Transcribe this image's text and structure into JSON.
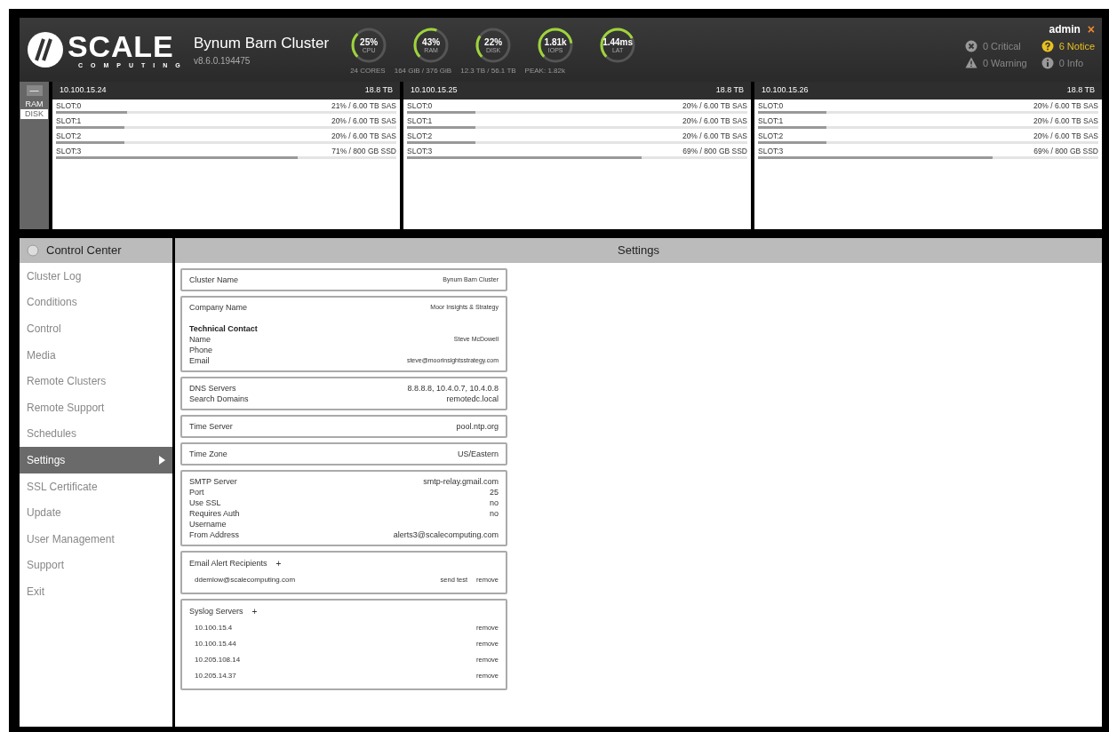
{
  "brand": {
    "logo": "SCALE",
    "tagline": "COMPUTING",
    "version": "v8.6.0.194475",
    "cluster": "Bynum Barn Cluster"
  },
  "gauges": [
    {
      "value": "25%",
      "label": "CPU",
      "level": 0.25
    },
    {
      "value": "43%",
      "label": "RAM",
      "level": 0.43
    },
    {
      "value": "22%",
      "label": "DISK",
      "level": 0.22
    },
    {
      "value": "1.81k",
      "label": "IOPS",
      "level": 0.6
    },
    {
      "value": "1.44ms",
      "label": "LAT",
      "level": 0.55
    }
  ],
  "gauge_notes": [
    "24 CORES",
    "164 GiB / 376 GiB",
    "12.3 TB / 56.1 TB",
    "PEAK: 1.82k"
  ],
  "user": {
    "name": "admin",
    "close": "×"
  },
  "alerts": [
    {
      "kind": "critical",
      "text": "0 Critical",
      "active": false
    },
    {
      "kind": "notice",
      "text": "6 Notice",
      "active": true
    },
    {
      "kind": "warning",
      "text": "0 Warning",
      "active": false
    },
    {
      "kind": "info",
      "text": "0 Info",
      "active": false
    }
  ],
  "view_toggle": {
    "collapse": "—",
    "options": [
      {
        "label": "RAM",
        "selected": false
      },
      {
        "label": "DISK",
        "selected": true
      }
    ]
  },
  "nodes": [
    {
      "ip": "10.100.15.24",
      "capacity": "18.8 TB",
      "slots": [
        {
          "name": "SLOT:0",
          "reading": "21% / 6.00 TB SAS",
          "level": 0.21
        },
        {
          "name": "SLOT:1",
          "reading": "20% / 6.00 TB SAS",
          "level": 0.2
        },
        {
          "name": "SLOT:2",
          "reading": "20% / 6.00 TB SAS",
          "level": 0.2
        },
        {
          "name": "SLOT:3",
          "reading": "71% / 800 GB SSD",
          "level": 0.71
        }
      ]
    },
    {
      "ip": "10.100.15.25",
      "capacity": "18.8 TB",
      "slots": [
        {
          "name": "SLOT:0",
          "reading": "20% / 6.00 TB SAS",
          "level": 0.2
        },
        {
          "name": "SLOT:1",
          "reading": "20% / 6.00 TB SAS",
          "level": 0.2
        },
        {
          "name": "SLOT:2",
          "reading": "20% / 6.00 TB SAS",
          "level": 0.2
        },
        {
          "name": "SLOT:3",
          "reading": "69% / 800 GB SSD",
          "level": 0.69
        }
      ]
    },
    {
      "ip": "10.100.15.26",
      "capacity": "18.8 TB",
      "slots": [
        {
          "name": "SLOT:0",
          "reading": "20% / 6.00 TB SAS",
          "level": 0.2
        },
        {
          "name": "SLOT:1",
          "reading": "20% / 6.00 TB SAS",
          "level": 0.2
        },
        {
          "name": "SLOT:2",
          "reading": "20% / 6.00 TB SAS",
          "level": 0.2
        },
        {
          "name": "SLOT:3",
          "reading": "69% / 800 GB SSD",
          "level": 0.69
        }
      ]
    }
  ],
  "sidebar": {
    "title": "Control Center",
    "items": [
      {
        "label": "Cluster Log",
        "selected": false
      },
      {
        "label": "Conditions",
        "selected": false
      },
      {
        "label": "Control",
        "selected": false
      },
      {
        "label": "Media",
        "selected": false
      },
      {
        "label": "Remote Clusters",
        "selected": false
      },
      {
        "label": "Remote Support",
        "selected": false
      },
      {
        "label": "Schedules",
        "selected": false
      },
      {
        "label": "Settings",
        "selected": true
      },
      {
        "label": "SSL Certificate",
        "selected": false
      },
      {
        "label": "Update",
        "selected": false
      },
      {
        "label": "User Management",
        "selected": false
      },
      {
        "label": "Support",
        "selected": false
      },
      {
        "label": "Exit",
        "selected": false
      }
    ]
  },
  "settings": {
    "title": "Settings",
    "sections": [
      {
        "kind": "fields",
        "rows": [
          {
            "kind": "field",
            "label": "Cluster Name",
            "value": "Bynum Barn Cluster",
            "small": true
          }
        ]
      },
      {
        "kind": "fields",
        "rows": [
          {
            "kind": "field",
            "label": "Company Name",
            "value": "Moor Insights & Strategy",
            "small": true
          },
          {
            "kind": "heading",
            "label": "Technical Contact"
          },
          {
            "kind": "field",
            "label": "Name",
            "value": "Steve McDowell",
            "small": true
          },
          {
            "kind": "field",
            "label": "Phone"
          },
          {
            "kind": "field",
            "label": "Email",
            "value": "steve@moorinsightsstrategy.com",
            "small": true
          }
        ]
      },
      {
        "kind": "fields",
        "rows": [
          {
            "kind": "field",
            "label": "DNS Servers",
            "value": "8.8.8.8, 10.4.0.7, 10.4.0.8"
          },
          {
            "kind": "field",
            "label": "Search Domains",
            "value": "remotedc.local"
          }
        ]
      },
      {
        "kind": "fields",
        "rows": [
          {
            "kind": "field",
            "label": "Time Server",
            "value": "pool.ntp.org"
          }
        ]
      },
      {
        "kind": "fields",
        "rows": [
          {
            "kind": "field",
            "label": "Time Zone",
            "value": "US/Eastern"
          }
        ]
      },
      {
        "kind": "fields",
        "rows": [
          {
            "kind": "field",
            "label": "SMTP Server",
            "value": "smtp-relay.gmail.com"
          },
          {
            "kind": "field",
            "label": "Port",
            "value": "25"
          },
          {
            "kind": "field",
            "label": "Use SSL",
            "value": "no"
          },
          {
            "kind": "field",
            "label": "Requires Auth",
            "value": "no"
          },
          {
            "kind": "field",
            "label": "Username"
          },
          {
            "kind": "field",
            "label": "From Address",
            "value": "alerts3@scalecomputing.com"
          }
        ]
      },
      {
        "kind": "list",
        "title": "Email Alert Recipients",
        "add": "+",
        "items": [
          {
            "text": "ddemlow@scalecomputing.com",
            "actions": [
              "send test",
              "remove"
            ]
          }
        ]
      },
      {
        "kind": "list",
        "title": "Syslog Servers",
        "add": "+",
        "items": [
          {
            "text": "10.100.15.4",
            "actions": [
              "remove"
            ]
          },
          {
            "text": "10.100.15.44",
            "actions": [
              "remove"
            ]
          },
          {
            "text": "10.205.108.14",
            "actions": [
              "remove"
            ]
          },
          {
            "text": "10.205.14.37",
            "actions": [
              "remove"
            ]
          }
        ]
      }
    ]
  }
}
